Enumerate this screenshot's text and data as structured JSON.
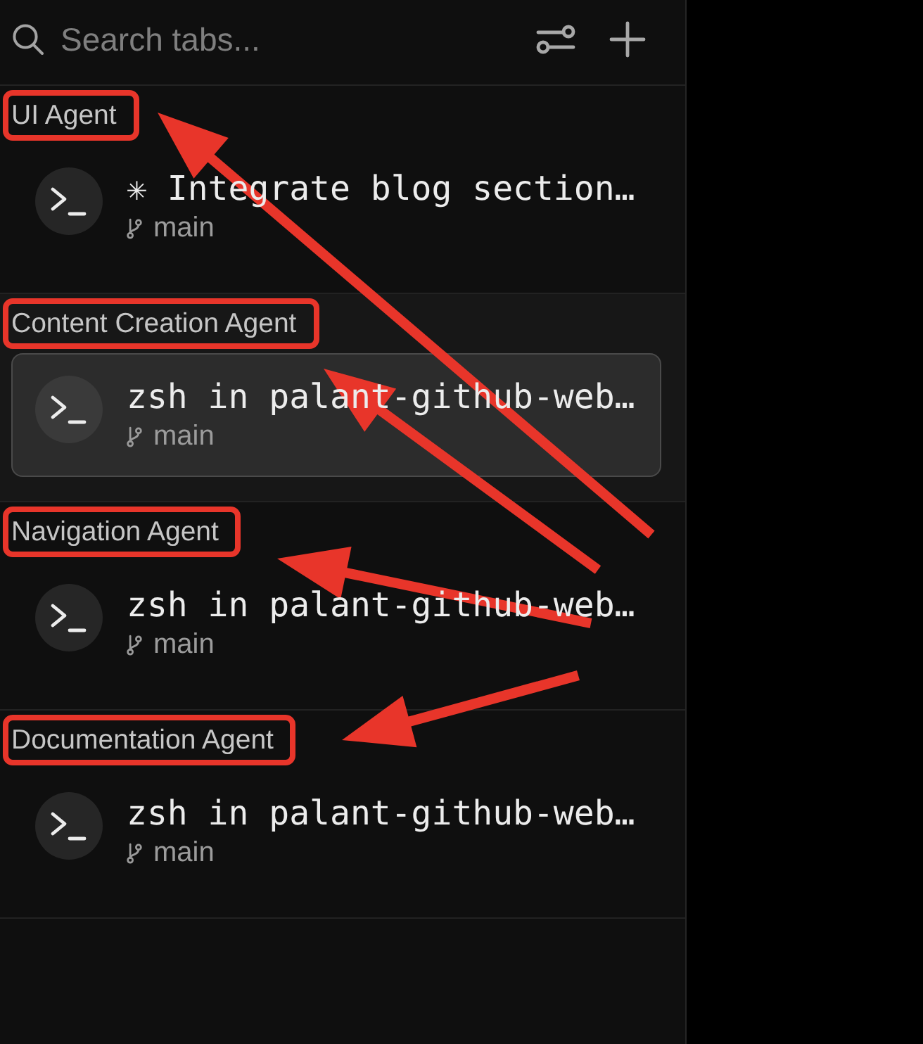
{
  "search": {
    "placeholder": "Search tabs..."
  },
  "groups": [
    {
      "label": "UI Agent",
      "annotation": {
        "boxed": true,
        "arrow": true
      },
      "tabs": [
        {
          "title": "✳ Integrate blog section…",
          "branch": "main",
          "selected": false
        }
      ]
    },
    {
      "label": "Content Creation Agent",
      "annotation": {
        "boxed": true,
        "arrow": true
      },
      "tabs": [
        {
          "title": "zsh in palant-github-web…",
          "branch": "main",
          "selected": true
        }
      ]
    },
    {
      "label": "Navigation Agent",
      "annotation": {
        "boxed": true,
        "arrow": true
      },
      "tabs": [
        {
          "title": "zsh in palant-github-web…",
          "branch": "main",
          "selected": false
        }
      ]
    },
    {
      "label": "Documentation Agent",
      "annotation": {
        "boxed": true,
        "arrow": true
      },
      "tabs": [
        {
          "title": "zsh in palant-github-web…",
          "branch": "main",
          "selected": false
        }
      ]
    }
  ]
}
